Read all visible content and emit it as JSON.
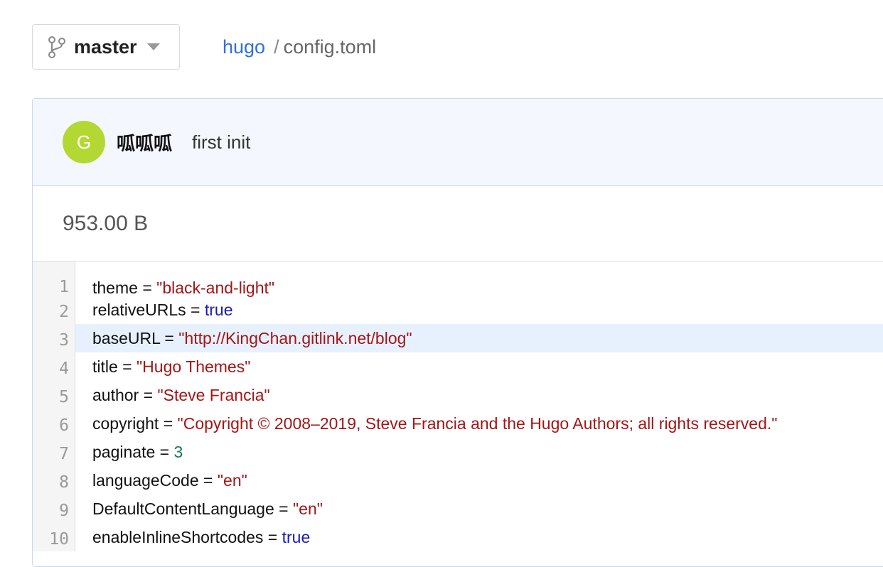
{
  "header": {
    "branch": "master",
    "repo": "hugo",
    "separator": "/",
    "file": "config.toml"
  },
  "commit": {
    "avatar_letter": "G",
    "avatar_color": "#b4d833",
    "author": "呱呱呱",
    "message": "first init"
  },
  "file_size": "953.00 B",
  "code_lines": [
    {
      "no": "1",
      "key": "theme",
      "eq": " = ",
      "value": "\"black-and-light\"",
      "type": "str"
    },
    {
      "no": "2",
      "key": "relativeURLs",
      "eq": " = ",
      "value": "true",
      "type": "bool"
    },
    {
      "no": "3",
      "key": "baseURL",
      "eq": " = ",
      "value": "\"http://KingChan.gitlink.net/blog\"",
      "type": "str"
    },
    {
      "no": "4",
      "key": "title",
      "eq": " = ",
      "value": "\"Hugo Themes\"",
      "type": "str"
    },
    {
      "no": "5",
      "key": "author",
      "eq": " = ",
      "value": "\"Steve Francia\"",
      "type": "str"
    },
    {
      "no": "6",
      "key": "copyright",
      "eq": " = ",
      "value": "\"Copyright © 2008–2019, Steve Francia and the Hugo Authors; all rights reserved.\"",
      "type": "str"
    },
    {
      "no": "7",
      "key": "paginate",
      "eq": " = ",
      "value": "3",
      "type": "num"
    },
    {
      "no": "8",
      "key": "languageCode",
      "eq": " = ",
      "value": "\"en\"",
      "type": "str"
    },
    {
      "no": "9",
      "key": "DefaultContentLanguage",
      "eq": " = ",
      "value": "\"en\"",
      "type": "str"
    },
    {
      "no": "10",
      "key": "enableInlineShortcodes",
      "eq": " = ",
      "value": "true",
      "type": "bool"
    }
  ]
}
